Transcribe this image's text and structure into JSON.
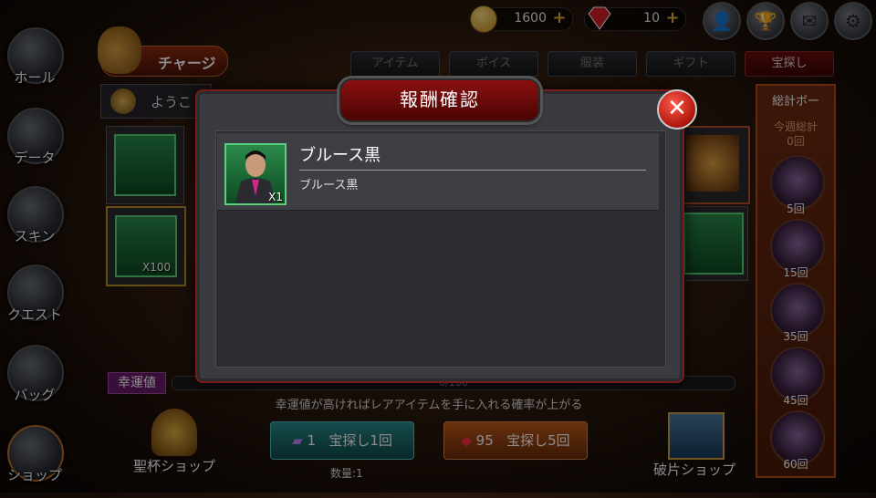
{
  "sidebar": {
    "items": [
      {
        "label": "ホール"
      },
      {
        "label": "データ"
      },
      {
        "label": "スキン"
      },
      {
        "label": "クエスト"
      },
      {
        "label": "バッグ"
      },
      {
        "label": "ショップ"
      }
    ]
  },
  "topbar": {
    "gold": "1600",
    "gems": "10",
    "charge_label": "チャージ"
  },
  "tabs": [
    {
      "label": "アイテム",
      "active": false
    },
    {
      "label": "ボイス",
      "active": false
    },
    {
      "label": "服装",
      "active": false
    },
    {
      "label": "ギフト",
      "active": false
    },
    {
      "label": "宝探し",
      "active": true
    }
  ],
  "welcome_text": "ようこ",
  "background_items": {
    "x100_label": "X100"
  },
  "right_panel": {
    "title": "総計ボー",
    "weekly_label": "今週総計",
    "weekly_count": "0回",
    "milestones": [
      "5回",
      "15回",
      "35回",
      "45回",
      "60回"
    ]
  },
  "luck": {
    "label": "幸運値",
    "progress_text": "0/100",
    "progress": 0,
    "hint": "幸運値が高ければレアアイテムを手に入れる確率が上がる"
  },
  "bottom": {
    "grail_shop": "聖杯ショップ",
    "fragment_shop": "破片ショップ",
    "search1_cost": "1",
    "search1_label": "宝探し1回",
    "search5_cost": "95",
    "search5_label": "宝探し5回",
    "quantity_label": "数量:1"
  },
  "modal": {
    "title": "報酬確認",
    "reward": {
      "name": "ブルース黒",
      "description": "ブルース黒",
      "quantity": "X1"
    }
  },
  "colors": {
    "accent_red": "#8a1010",
    "item_frame_green": "#5cd07a",
    "gold": "#e0b040"
  }
}
